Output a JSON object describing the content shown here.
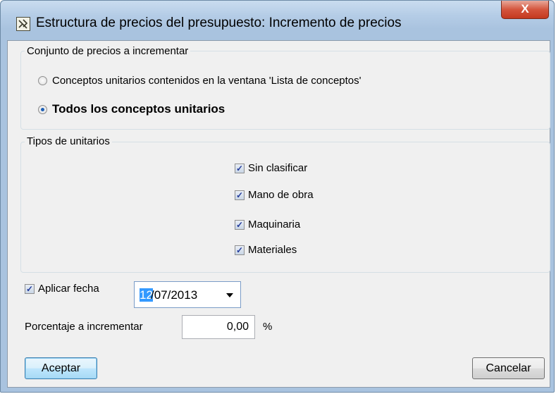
{
  "window": {
    "title": "Estructura de precios del presupuesto: Incremento de precios",
    "close_glyph": "X"
  },
  "group1": {
    "label": "Conjunto de precios a incrementar",
    "options": [
      {
        "label": "Conceptos unitarios contenidos en la ventana 'Lista de conceptos'",
        "selected": false
      },
      {
        "label": "Todos los conceptos unitarios",
        "selected": true
      }
    ]
  },
  "group2": {
    "label": "Tipos de unitarios",
    "checks": [
      {
        "label": "Sin clasificar",
        "checked": true
      },
      {
        "label": "Mano de obra",
        "checked": true
      },
      {
        "label": "Maquinaria",
        "checked": true
      },
      {
        "label": "Materiales",
        "checked": true
      }
    ]
  },
  "fecha": {
    "label": "Aplicar fecha",
    "checked": true,
    "date_selected": "12",
    "date_rest": "/07/2013"
  },
  "porcentaje": {
    "label": "Porcentaje a incrementar",
    "value": "0,00",
    "unit": "%"
  },
  "buttons": {
    "ok": "Aceptar",
    "cancel": "Cancelar"
  },
  "icons": {
    "app": "app-icon",
    "check": "✓"
  }
}
